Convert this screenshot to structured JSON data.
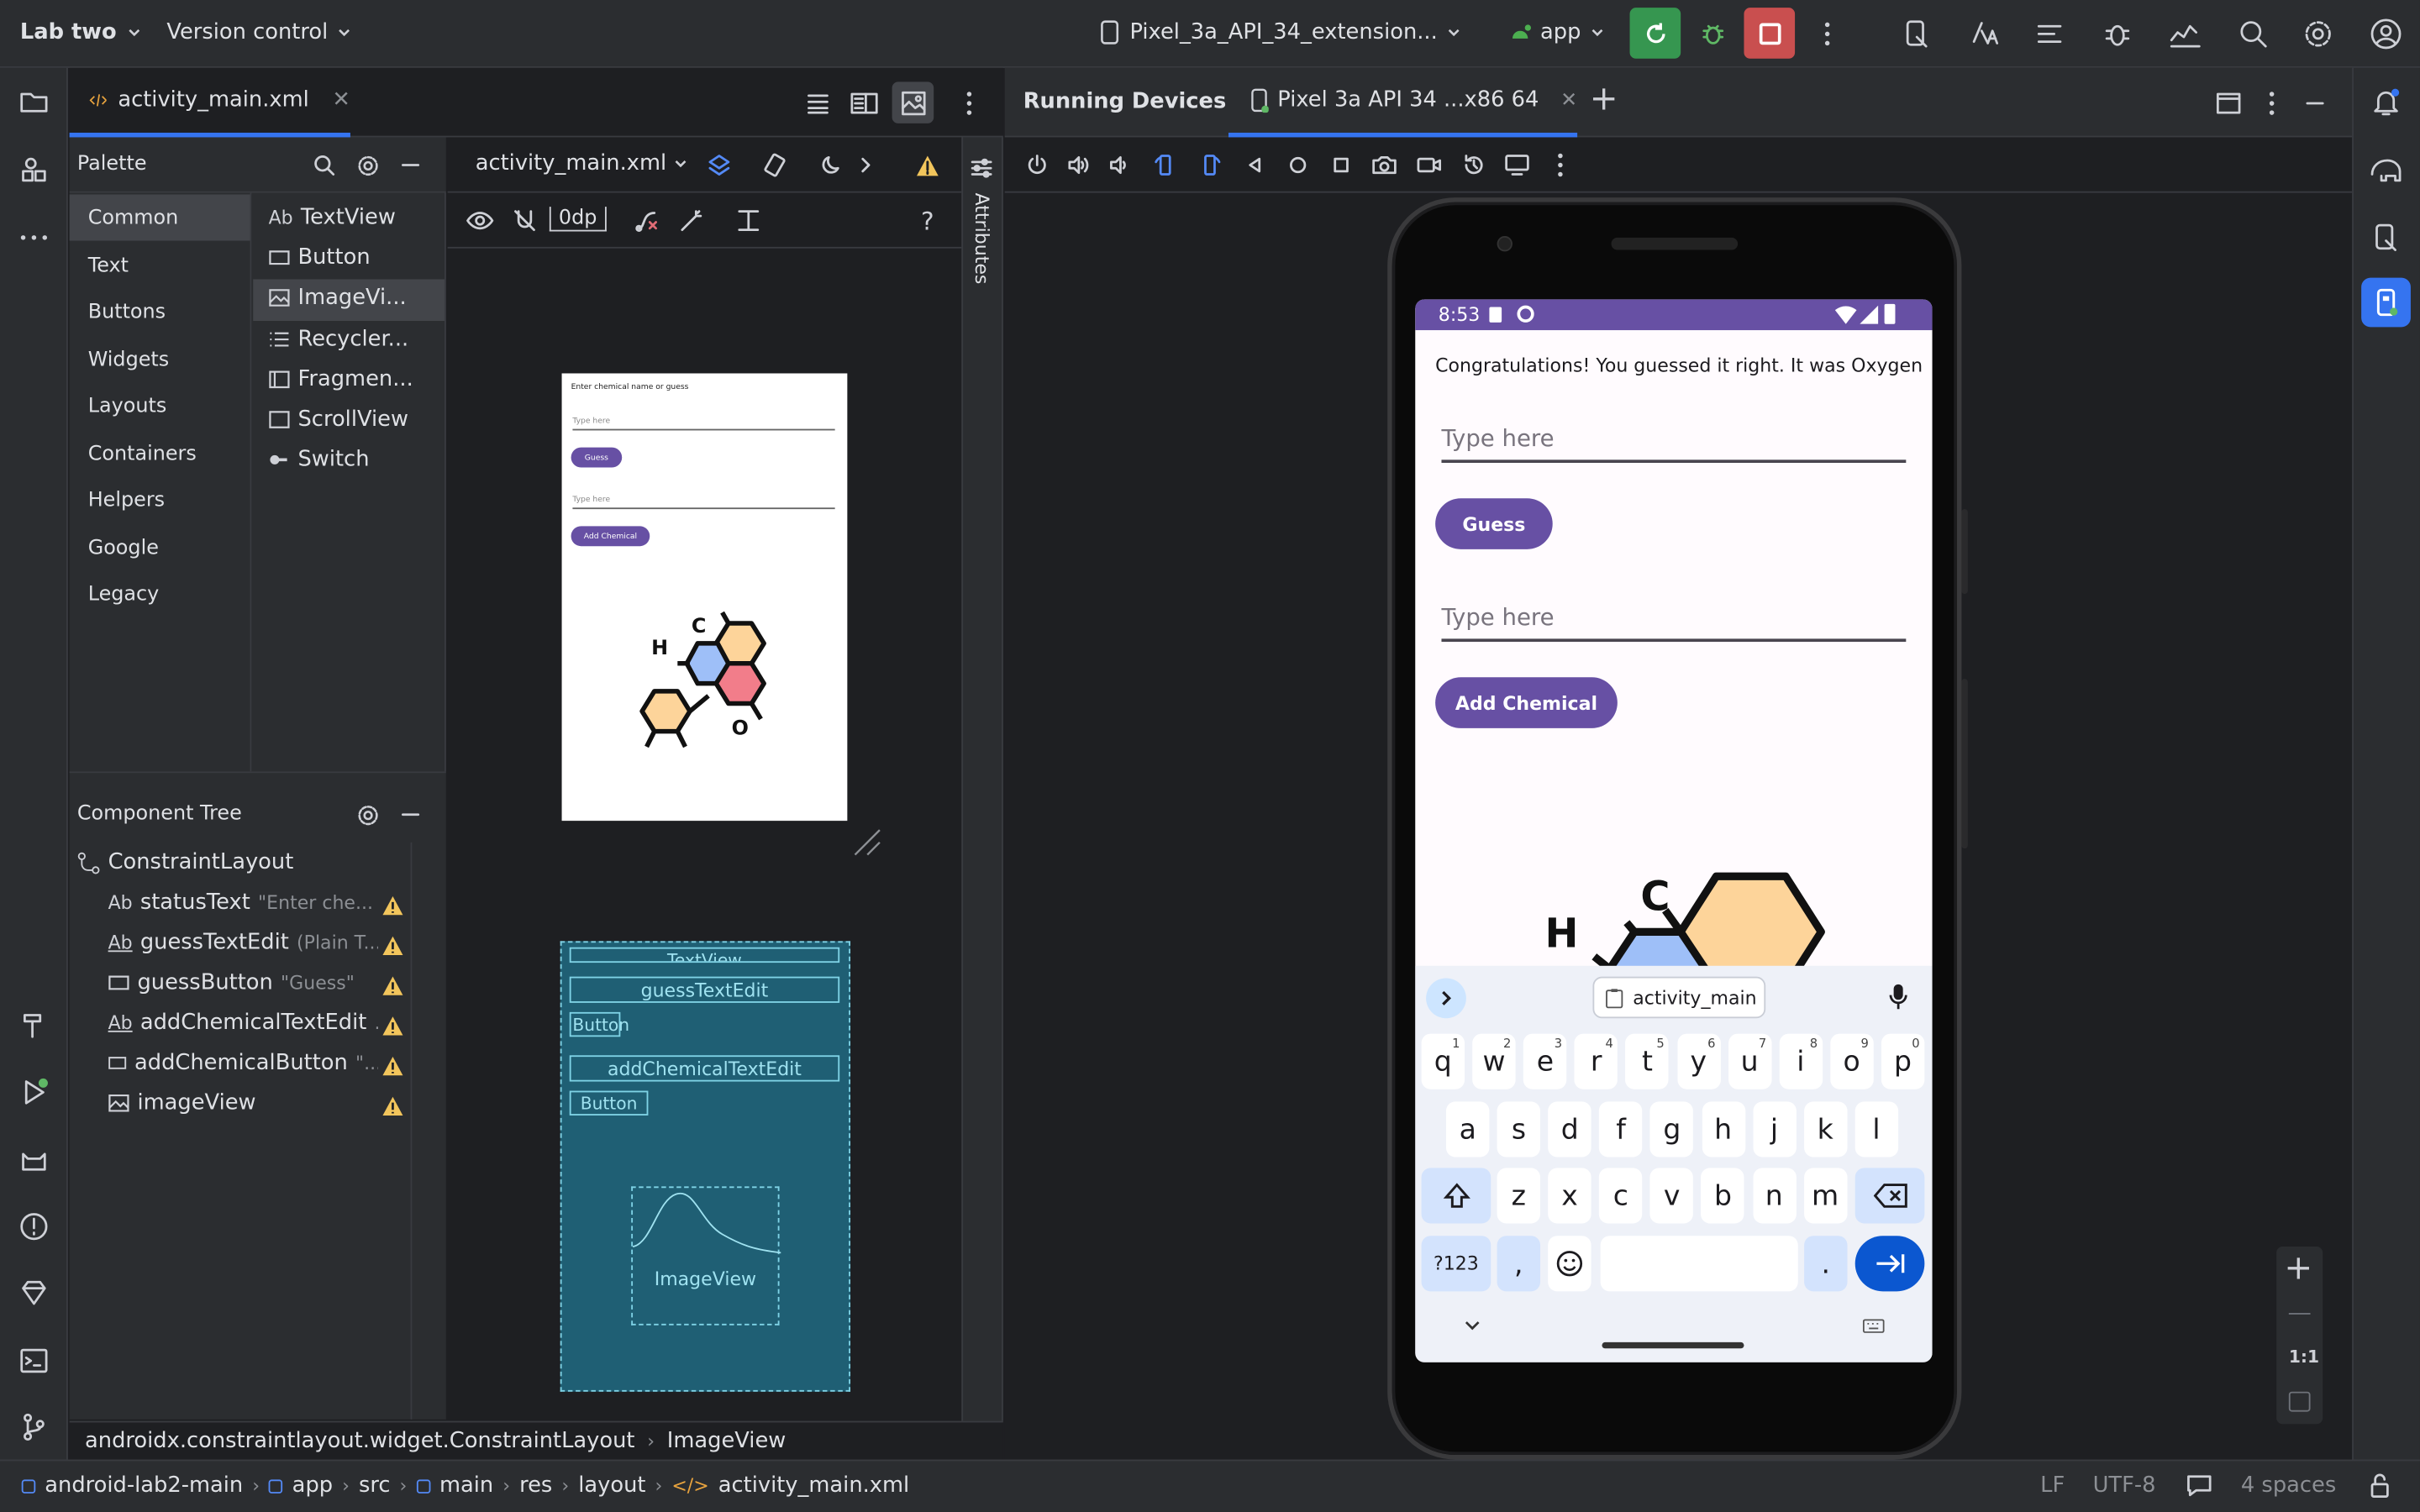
{
  "colors": {
    "accent": "#3574f0",
    "run_green": "#369650",
    "stop_red": "#c94f4f",
    "warning": "#f2c55c",
    "device_purple": "#6750a4"
  },
  "topbar": {
    "project": "Lab two",
    "vcs": "Version control",
    "device_selector": "Pixel_3a_API_34_extension...",
    "run_config": "app"
  },
  "editor": {
    "tab": "activity_main.xml",
    "file_selector": "activity_main.xml",
    "dp_value": "0dp"
  },
  "palette": {
    "title": "Palette",
    "categories": [
      "Common",
      "Text",
      "Buttons",
      "Widgets",
      "Layouts",
      "Containers",
      "Helpers",
      "Google",
      "Legacy"
    ],
    "items": [
      {
        "icon": "Ab",
        "label": "TextView"
      },
      {
        "icon": "button-icon",
        "label": "Button"
      },
      {
        "icon": "image-icon",
        "label": "ImageVi..."
      },
      {
        "icon": "list-icon",
        "label": "Recycler..."
      },
      {
        "icon": "fragment-icon",
        "label": "Fragmen..."
      },
      {
        "icon": "scroll-icon",
        "label": "ScrollView"
      },
      {
        "icon": "switch-icon",
        "label": "Switch"
      }
    ]
  },
  "component_tree": {
    "title": "Component Tree",
    "root": "ConstraintLayout",
    "items": [
      {
        "icon": "Ab",
        "name": "statusText",
        "hint": "\"Enter che..."
      },
      {
        "icon": "Ab",
        "name": "guessTextEdit",
        "hint": "(Plain T..."
      },
      {
        "icon": "button-icon",
        "name": "guessButton",
        "hint": "\"Guess\""
      },
      {
        "icon": "Ab",
        "name": "addChemicalTextEdit",
        "hint": "..."
      },
      {
        "icon": "button-icon",
        "name": "addChemicalButton",
        "hint": "\"..."
      },
      {
        "icon": "image-icon",
        "name": "imageView",
        "hint": ""
      }
    ]
  },
  "attributes_label": "Attributes",
  "design_preview": {
    "status": "Enter chemical name or guess",
    "hint1": "Type here",
    "btn1": "Guess",
    "hint2": "Type here",
    "btn2": "Add Chemical"
  },
  "blueprint": {
    "textview": "TextView",
    "guess": "guessTextEdit",
    "button1": "Button",
    "add": "addChemicalTextEdit",
    "button2": "Button",
    "imageview": "ImageView"
  },
  "breadcrumb_bottom": [
    "androidx.constraintlayout.widget.ConstraintLayout",
    "ImageView"
  ],
  "running_devices": {
    "title": "Running Devices",
    "tab": "Pixel 3a API 34 ...x86 64"
  },
  "phone": {
    "time": "8:53",
    "status_text": "Congratulations! You guessed it right. It was Oxygen",
    "hint1": "Type here",
    "btn1": "Guess",
    "hint2": "Type here",
    "btn2": "Add Chemical",
    "keyboard_chip": "activity_main",
    "row1": [
      {
        "k": "q",
        "n": "1"
      },
      {
        "k": "w",
        "n": "2"
      },
      {
        "k": "e",
        "n": "3"
      },
      {
        "k": "r",
        "n": "4"
      },
      {
        "k": "t",
        "n": "5"
      },
      {
        "k": "y",
        "n": "6"
      },
      {
        "k": "u",
        "n": "7"
      },
      {
        "k": "i",
        "n": "8"
      },
      {
        "k": "o",
        "n": "9"
      },
      {
        "k": "p",
        "n": "0"
      }
    ],
    "row2": [
      "a",
      "s",
      "d",
      "f",
      "g",
      "h",
      "j",
      "k",
      "l"
    ],
    "row3": [
      "z",
      "x",
      "c",
      "v",
      "b",
      "n",
      "m"
    ],
    "sym": "?123",
    "comma": ",",
    "period": "."
  },
  "zoom": {
    "reset": "1:1"
  },
  "statusbar": {
    "path": [
      "android-lab2-main",
      "app",
      "src",
      "main",
      "res",
      "layout",
      "activity_main.xml"
    ],
    "line_sep": "LF",
    "encoding": "UTF-8",
    "indent": "4 spaces"
  }
}
